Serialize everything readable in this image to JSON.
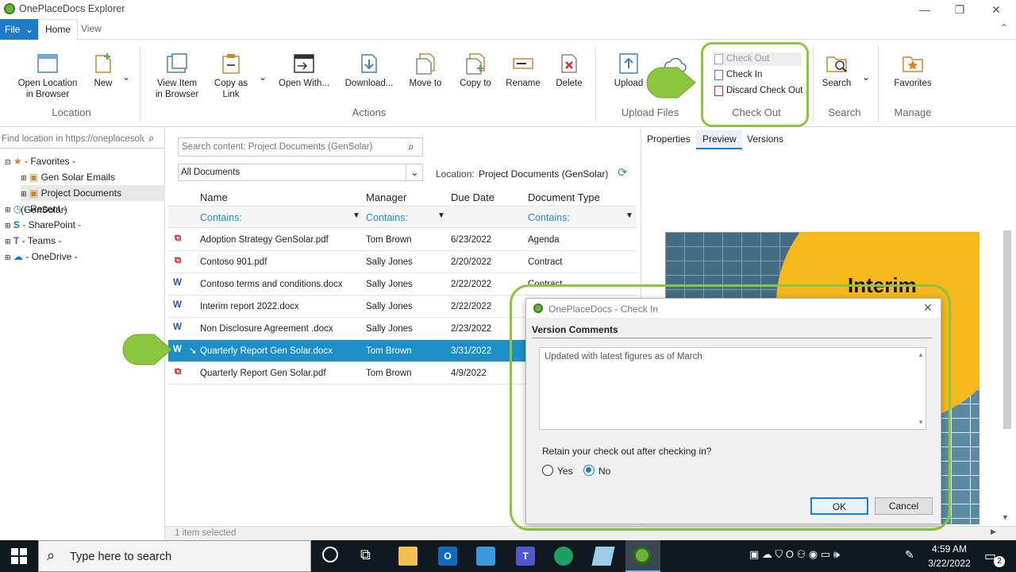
{
  "window": {
    "title": "OnePlaceDocs Explorer",
    "minimize": "—",
    "maximize": "❐",
    "close": "✕"
  },
  "menu": {
    "file": "File",
    "tabs": [
      "Home",
      "View"
    ]
  },
  "ribbon": {
    "location": {
      "label": "Location",
      "buttons": [
        {
          "line1": "Open Location",
          "line2": "in Browser"
        },
        {
          "line1": "New",
          "line2": ""
        }
      ]
    },
    "actions": {
      "label": "Actions",
      "buttons": [
        {
          "line1": "View Item",
          "line2": "in Browser"
        },
        {
          "line1": "Copy as",
          "line2": "Link"
        },
        {
          "line1": "Open With...",
          "line2": ""
        },
        {
          "line1": "Download...",
          "line2": ""
        },
        {
          "line1": "Move to",
          "line2": ""
        },
        {
          "line1": "Copy to",
          "line2": ""
        },
        {
          "line1": "Rename",
          "line2": ""
        },
        {
          "line1": "Delete",
          "line2": ""
        }
      ]
    },
    "upload": {
      "label": "Upload Files",
      "button": "Upload"
    },
    "checkout": {
      "label": "Check Out",
      "items": [
        "Check Out",
        "Check In",
        "Discard Check Out"
      ]
    },
    "search": {
      "label": "Search",
      "button": "Search"
    },
    "manage": {
      "label": "Manage",
      "button": "Favorites"
    }
  },
  "left": {
    "find_placeholder": "Find location in https://oneplacesoluti",
    "tree": {
      "favorites": "- Favorites -",
      "fav_items": [
        "Gen Solar Emails (GenSolar)",
        "Project Documents (GenSolar)"
      ],
      "recent": "- Recent -",
      "sharepoint": "- SharePoint -",
      "teams": "- Teams -",
      "onedrive": "- OneDrive -"
    }
  },
  "center": {
    "search_placeholder": "Search content: Project Documents (GenSolar)",
    "view": "All Documents",
    "location_label": "Location:",
    "location_value": "Project Documents (GenSolar)",
    "columns": [
      "Name",
      "Manager",
      "Due Date",
      "Document Type"
    ],
    "filter": "Contains:",
    "rows": [
      {
        "name": "Adoption Strategy GenSolar.pdf",
        "manager": "Tom Brown",
        "due": "6/23/2022",
        "type": "Agenda",
        "kind": "pdf"
      },
      {
        "name": "Contoso 901.pdf",
        "manager": "Sally Jones",
        "due": "2/20/2022",
        "type": "Contract",
        "kind": "pdf"
      },
      {
        "name": "Contoso terms and conditions.docx",
        "manager": "Sally Jones",
        "due": "2/22/2022",
        "type": "Contract",
        "kind": "doc"
      },
      {
        "name": "Interim report 2022.docx",
        "manager": "Sally Jones",
        "due": "2/22/2022",
        "type": "",
        "kind": "doc"
      },
      {
        "name": "Non Disclosure Agreement .docx",
        "manager": "Sally Jones",
        "due": "2/23/2022",
        "type": "",
        "kind": "doc"
      },
      {
        "name": "Quarterly Report Gen Solar.docx",
        "manager": "Tom Brown",
        "due": "3/31/2022",
        "type": "",
        "kind": "doc"
      },
      {
        "name": "Quarterly Report Gen Solar.pdf",
        "manager": "Tom Brown",
        "due": "4/9/2022",
        "type": "",
        "kind": "pdf"
      }
    ],
    "status": "1 item selected"
  },
  "right": {
    "tabs": [
      "Properties",
      "Preview",
      "Versions"
    ],
    "preview_text": "Interim"
  },
  "dialog": {
    "title": "OnePlaceDocs - Check In",
    "section": "Version Comments",
    "comment": "Updated with latest figures as of March",
    "question": "Retain your check out after checking in?",
    "yes": "Yes",
    "no": "No",
    "ok": "OK",
    "cancel": "Cancel"
  },
  "taskbar": {
    "search_placeholder": "Type here to search",
    "time": "4:59 AM",
    "date": "3/22/2022",
    "notifications": "2"
  },
  "colors": {
    "accent": "#1e7bc8",
    "selection": "#1e8fc6",
    "callout": "#8cc63f",
    "filter": "#1e8fc6"
  }
}
